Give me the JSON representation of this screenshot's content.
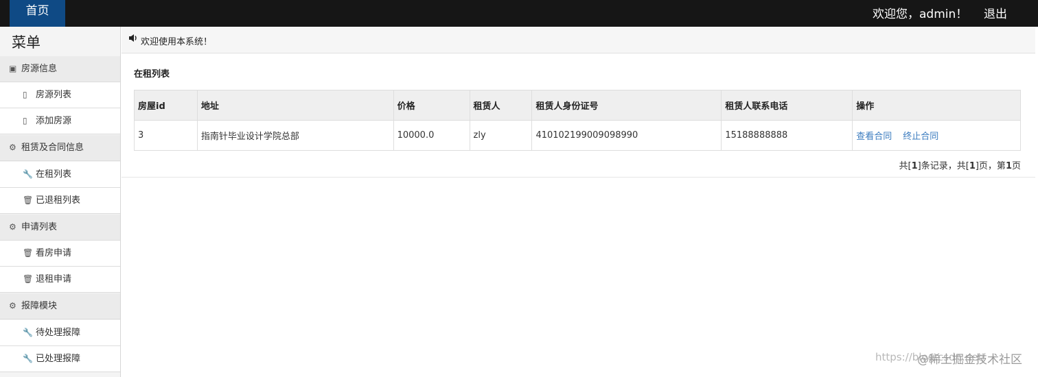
{
  "header": {
    "home_tab": "首页",
    "welcome": "欢迎您，admin！",
    "logout": "退出"
  },
  "sidebar": {
    "title": "菜单",
    "rows": [
      {
        "type": "group",
        "icon": "book-icon",
        "glyph": "▣",
        "label": "房源信息"
      },
      {
        "type": "item",
        "icon": "file-icon",
        "glyph": "▯",
        "label": "房源列表"
      },
      {
        "type": "item",
        "icon": "file-icon",
        "glyph": "▯",
        "label": "添加房源"
      },
      {
        "type": "group",
        "icon": "gear-icon",
        "glyph": "⚙",
        "label": "租赁及合同信息"
      },
      {
        "type": "item",
        "icon": "wrench-icon",
        "glyph": "🔧",
        "label": "在租列表"
      },
      {
        "type": "item",
        "icon": "trash-icon",
        "glyph": "🗑",
        "label": "已退租列表"
      },
      {
        "type": "group",
        "icon": "gear-icon",
        "glyph": "⚙",
        "label": "申请列表"
      },
      {
        "type": "item",
        "icon": "trash-icon",
        "glyph": "🗑",
        "label": "看房申请"
      },
      {
        "type": "item",
        "icon": "trash-icon",
        "glyph": "🗑",
        "label": "退租申请"
      },
      {
        "type": "group",
        "icon": "gear-icon",
        "glyph": "⚙",
        "label": "报障模块"
      },
      {
        "type": "item",
        "icon": "wrench-icon",
        "glyph": "🔧",
        "label": "待处理报障"
      },
      {
        "type": "item",
        "icon": "wrench-icon",
        "glyph": "🔧",
        "label": "已处理报障"
      }
    ]
  },
  "notice": {
    "icon": "speaker-icon",
    "text": "欢迎使用本系统！"
  },
  "main": {
    "section_title": "在租列表",
    "columns": [
      "房屋id",
      "地址",
      "价格",
      "租赁人",
      "租赁人身份证号",
      "租赁人联系电话",
      "操作"
    ],
    "rows": [
      {
        "house_id": "3",
        "address": "指南针毕业设计学院总部",
        "price": "10000.0",
        "tenant": "zly",
        "id_card": "410102199009098990",
        "phone": "15188888888",
        "actions": [
          "查看合同",
          "终止合同"
        ]
      }
    ],
    "pager": {
      "prefix": "共[",
      "records": "1",
      "mid1": "]条记录，共[",
      "pages": "1",
      "mid2": "]页，第",
      "current": "1",
      "suffix": "页"
    }
  },
  "watermark": {
    "url": "https://blog.csdn.net/",
    "brand": "@稀土掘金技术社区"
  }
}
